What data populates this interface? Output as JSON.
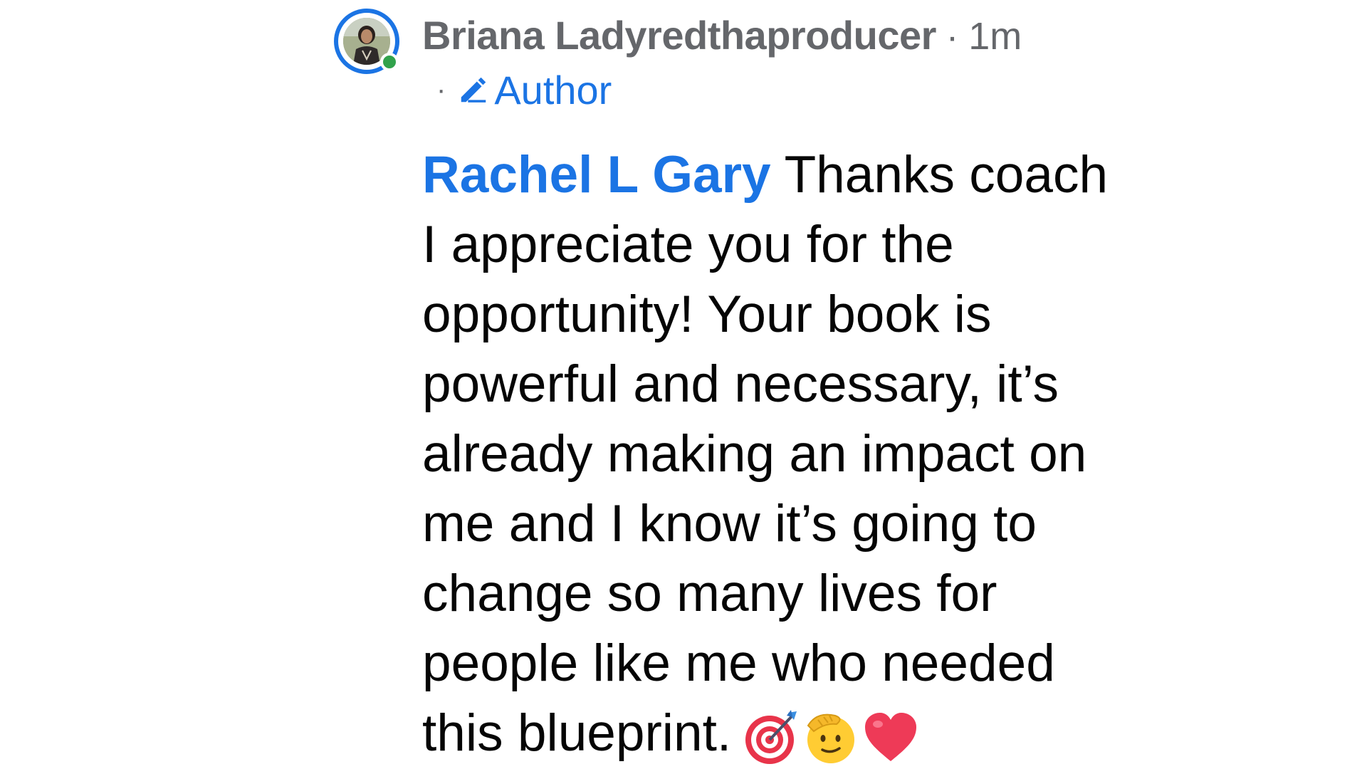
{
  "comment": {
    "author": "Briana Ladyredthaproducer",
    "separator": "·",
    "timestamp": "1m",
    "badge_separator": "·",
    "badge_label": "Author",
    "mention": "Rachel L Gary",
    "text_lines": [
      "Thanks coach",
      "I appreciate you for the",
      "opportunity! Your book is",
      "powerful and necessary, it’s",
      "already making an impact on",
      "me and I know it’s going to",
      "change so many lives for",
      "people like me who needed",
      "this blueprint."
    ],
    "emojis": [
      "direct-hit-emoji",
      "saluting-face-emoji",
      "red-heart-emoji"
    ]
  },
  "colors": {
    "accent": "#1b74e4",
    "secondary_text": "#65676b",
    "primary_text": "#050505",
    "online": "#31a24c"
  },
  "icons": {
    "badge": "pencil-icon",
    "status": "online-status-icon"
  }
}
